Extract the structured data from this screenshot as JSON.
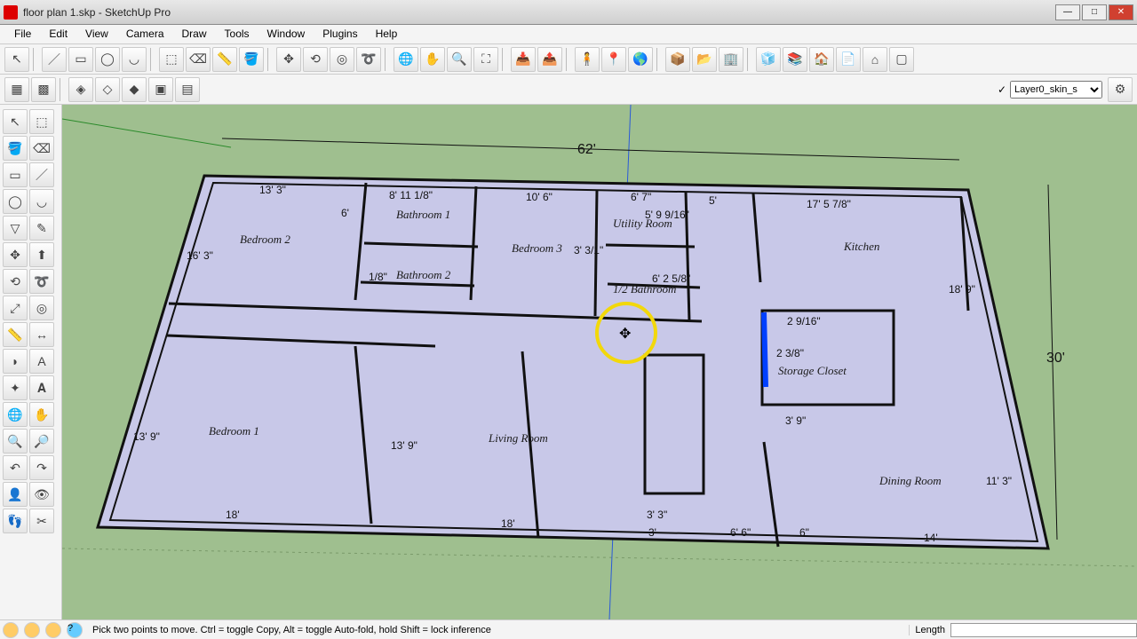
{
  "window": {
    "title": "floor plan 1.skp - SketchUp Pro",
    "min": "—",
    "max": "□",
    "close": "✕"
  },
  "menu": [
    "File",
    "Edit",
    "View",
    "Camera",
    "Draw",
    "Tools",
    "Window",
    "Plugins",
    "Help"
  ],
  "layer": {
    "selected": "Layer0_skin_s"
  },
  "status": {
    "hint": "Pick two points to move.  Ctrl = toggle Copy, Alt = toggle Auto-fold, hold Shift = lock inference",
    "length_label": "Length"
  },
  "overall": {
    "width": "62'",
    "height": "30'"
  },
  "rooms": {
    "bedroom1": "Bedroom 1",
    "bedroom2": "Bedroom 2",
    "bedroom3": "Bedroom 3",
    "bathroom1": "Bathroom 1",
    "bathroom2": "Bathroom 2",
    "half_bath": "1/2 Bathroom",
    "utility": "Utility Room",
    "kitchen": "Kitchen",
    "storage": "Storage Closet",
    "living": "Living Room",
    "dining": "Dining Room"
  },
  "dims": {
    "d1": "13' 3\"",
    "d2": "8' 11 1/8\"",
    "d3": "10' 6\"",
    "d4": "6' 7\"",
    "d5": "17' 5 7/8\"",
    "d6": "16' 3\"",
    "d7": "6'",
    "d8": "1/8\"",
    "d9": "5' 9 9/16\"",
    "d10": "5'",
    "d11": "3' 3/1\"",
    "d12": "6' 2 5/8\"",
    "d13": "18' 9\"",
    "d14": "2 9/16\"",
    "d15": "2 3/8\"",
    "d16": "3' 9\"",
    "d17": "13' 9\"",
    "d18": "13' 9\"",
    "d19": "18'",
    "d20": "18'",
    "d21": "3' 3\"",
    "d22": "3'",
    "d23": "6' 6\"",
    "d24": "6\"",
    "d25": "14'",
    "d26": "11' 3\""
  }
}
